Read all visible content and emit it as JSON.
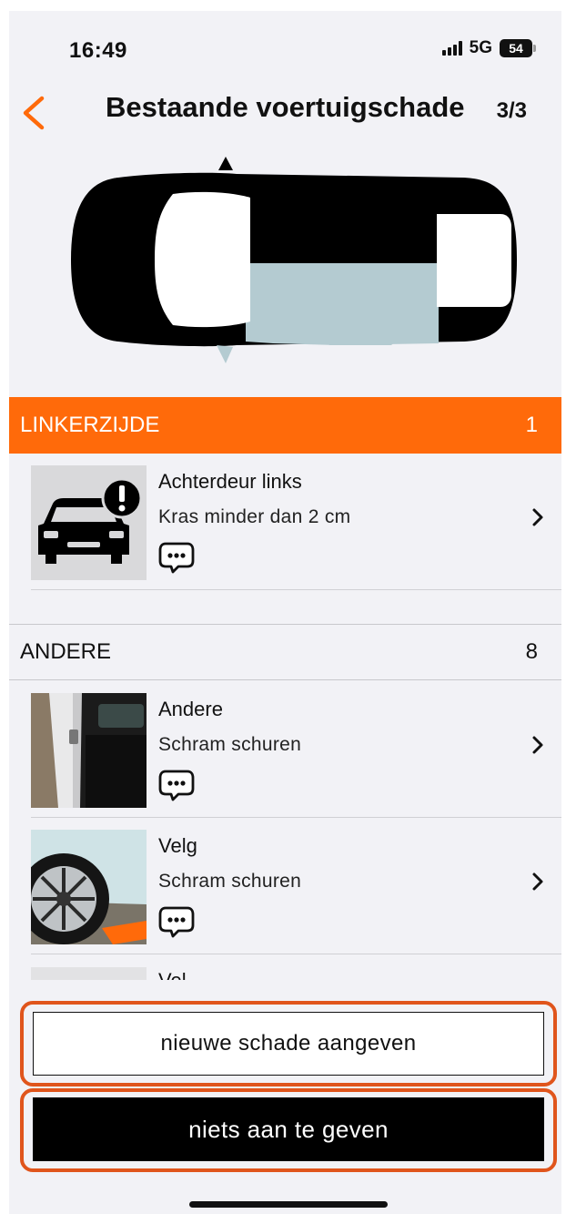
{
  "status_bar": {
    "time": "16:49",
    "network": "5G",
    "battery": "54"
  },
  "header": {
    "title": "Bestaande voertuigschade",
    "step": "3/3"
  },
  "sections": [
    {
      "title": "LINKERZIJDE",
      "count": "1",
      "items": [
        {
          "title": "Achterdeur links",
          "description": "Kras minder dan 2 cm",
          "thumbnail": "car-alert-icon"
        }
      ]
    },
    {
      "title": "ANDERE",
      "count": "8",
      "items": [
        {
          "title": "Andere",
          "description": "Schram schuren",
          "thumbnail": "photo-car-door"
        },
        {
          "title": "Velg",
          "description": "Schram schuren",
          "thumbnail": "photo-wheel-rim"
        },
        {
          "title": "Vel",
          "description": ""
        }
      ]
    }
  ],
  "buttons": {
    "report_new": "nieuwe schade aangeven",
    "nothing_to_report": "niets aan te geven"
  },
  "colors": {
    "accent": "#ff6a0a",
    "highlight_outline": "#e0551c",
    "damaged_area": "#b4cbd1",
    "background": "#f2f2f6"
  }
}
